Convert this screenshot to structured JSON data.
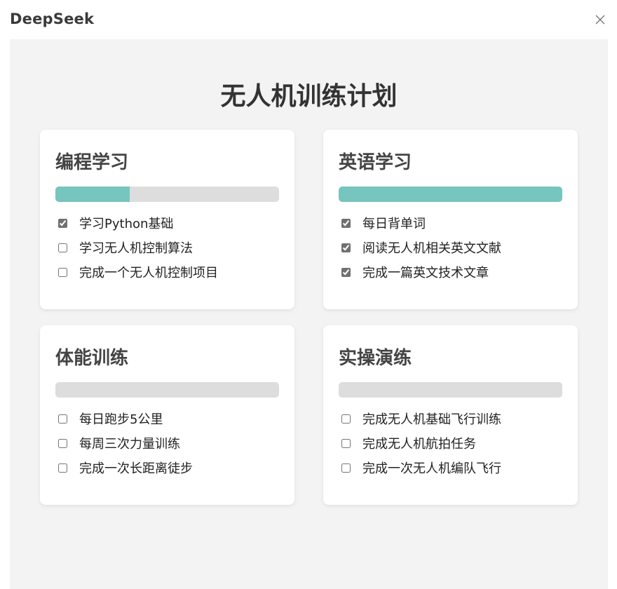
{
  "window": {
    "title": "DeepSeek"
  },
  "page": {
    "title": "无人机训练计划"
  },
  "theme": {
    "progress_color": "#76c5be",
    "track_color": "#dddddd",
    "background": "#f3f3f3"
  },
  "cards": [
    {
      "title": "编程学习",
      "progress": 0.333,
      "tasks": [
        {
          "label": "学习Python基础",
          "checked": true
        },
        {
          "label": "学习无人机控制算法",
          "checked": false
        },
        {
          "label": "完成一个无人机控制项目",
          "checked": false
        }
      ]
    },
    {
      "title": "英语学习",
      "progress": 1.0,
      "tasks": [
        {
          "label": "每日背单词",
          "checked": true
        },
        {
          "label": "阅读无人机相关英文文献",
          "checked": true
        },
        {
          "label": "完成一篇英文技术文章",
          "checked": true
        }
      ]
    },
    {
      "title": "体能训练",
      "progress": 0,
      "tasks": [
        {
          "label": "每日跑步5公里",
          "checked": false
        },
        {
          "label": "每周三次力量训练",
          "checked": false
        },
        {
          "label": "完成一次长距离徒步",
          "checked": false
        }
      ]
    },
    {
      "title": "实操演练",
      "progress": 0,
      "tasks": [
        {
          "label": "完成无人机基础飞行训练",
          "checked": false
        },
        {
          "label": "完成无人机航拍任务",
          "checked": false
        },
        {
          "label": "完成一次无人机编队飞行",
          "checked": false
        }
      ]
    }
  ]
}
